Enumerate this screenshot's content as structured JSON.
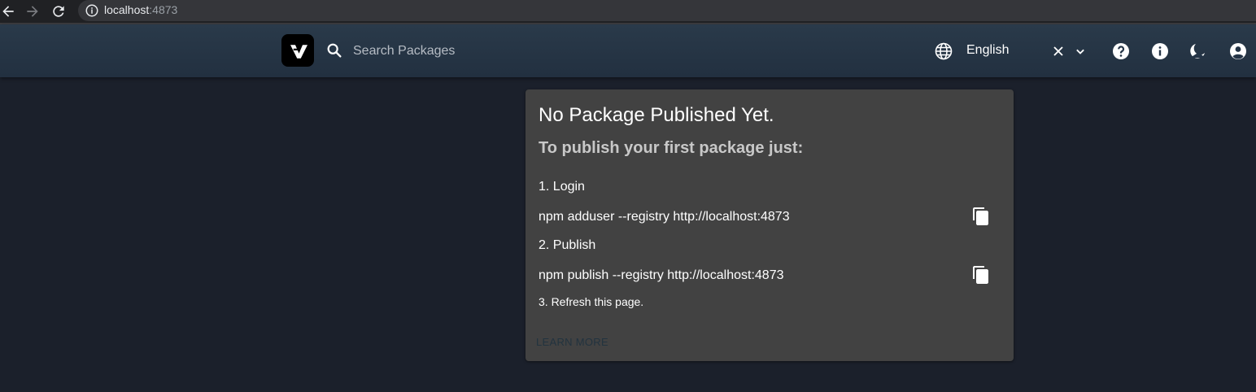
{
  "browser": {
    "url_host": "localhost",
    "url_port": ":4873"
  },
  "header": {
    "search_placeholder": "Search Packages",
    "language": "English",
    "icons": [
      "help-icon",
      "info-icon",
      "theme-toggle-icon",
      "account-icon"
    ]
  },
  "card": {
    "title": "No Package Published Yet.",
    "subtitle": "To publish your first package just:",
    "step1": "1. Login",
    "cmd1": "npm adduser --registry http://localhost:4873",
    "step2": "2. Publish",
    "cmd2": "npm publish --registry http://localhost:4873",
    "step3": "3. Refresh this page.",
    "learn_more": "LEARN MORE"
  },
  "colors": {
    "background": "#1b202b",
    "appbar": "#263545",
    "card": "#424242"
  }
}
